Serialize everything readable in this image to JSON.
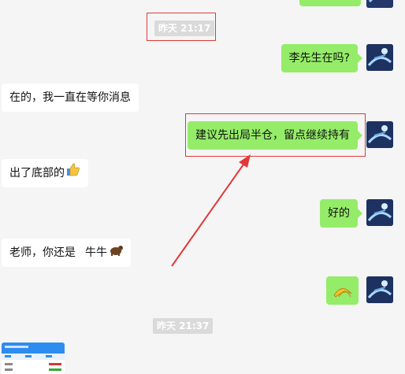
{
  "timestamps": [
    "昨天 21:17",
    "昨天 21:37"
  ],
  "messages": {
    "m1": "李先生在吗?",
    "m2": "在的，我一直在等你消息",
    "m3": "建议先出局半仓，留点继续持有",
    "m4": "出了底部的",
    "m5": "好的",
    "m6a": "老师，你还是",
    "m6b": "牛牛"
  },
  "icons": {
    "thumbs_up": "thumbs-up-icon",
    "bear": "bear-icon",
    "sticker": "banana-sticker-icon"
  },
  "colors": {
    "chat_bg": "#f5f5f5",
    "my_bubble": "#95ec69",
    "their_bubble": "#ffffff",
    "annotation_red": "#e0393a",
    "timestamp_bg": "#dadada"
  }
}
